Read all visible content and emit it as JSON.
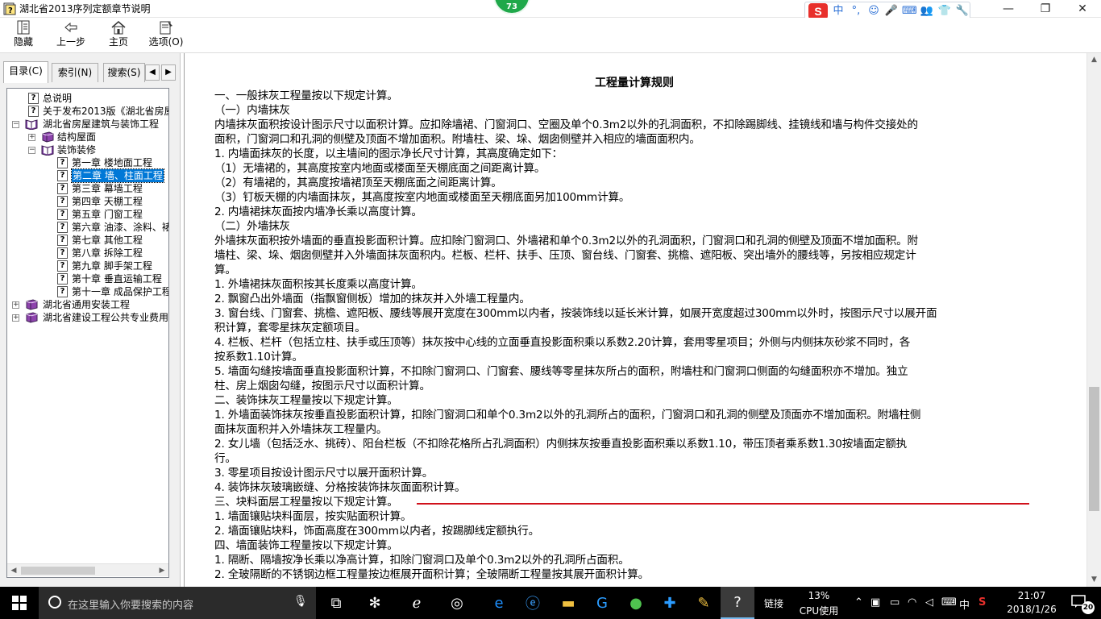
{
  "window": {
    "title": "湖北省2013序列定额章节说明",
    "badge": "73",
    "minimize": "—",
    "maximize": "❐",
    "close": "✕"
  },
  "ime": {
    "logo": "S",
    "items": [
      "中",
      "°,",
      "☺",
      "🎤",
      "⌨",
      "👥",
      "👕",
      "🔧"
    ]
  },
  "toolbar": {
    "hide_label": "隐藏",
    "back_label": "上一步",
    "home_label": "主页",
    "options_label": "选项(O)"
  },
  "nav": {
    "tabs": [
      "目录(C)",
      "索引(N)",
      "搜索(S)"
    ],
    "tab_prev": "◀",
    "tab_next": "▶"
  },
  "tree": [
    {
      "label": "总说明",
      "icon": "help-page-icon",
      "level": 1,
      "expander": ""
    },
    {
      "label": "关于发布2013版《湖北省房屋",
      "icon": "help-page-icon",
      "level": 1,
      "expander": ""
    },
    {
      "label": "湖北省房屋建筑与装饰工程",
      "icon": "open-book-icon",
      "level": 0,
      "expander": "−"
    },
    {
      "label": "结构屋面",
      "icon": "closed-book-icon",
      "level": 1,
      "expander": "+"
    },
    {
      "label": "装饰装修",
      "icon": "open-book-icon",
      "level": 1,
      "expander": "−"
    },
    {
      "label": "第一章 楼地面工程",
      "icon": "help-page-icon",
      "level": 2,
      "expander": ""
    },
    {
      "label": "第二章 墙、柱面工程",
      "icon": "help-page-icon",
      "level": 2,
      "expander": "",
      "selected": true
    },
    {
      "label": "第三章 幕墙工程",
      "icon": "help-page-icon",
      "level": 2,
      "expander": ""
    },
    {
      "label": "第四章 天棚工程",
      "icon": "help-page-icon",
      "level": 2,
      "expander": ""
    },
    {
      "label": "第五章 门窗工程",
      "icon": "help-page-icon",
      "level": 2,
      "expander": ""
    },
    {
      "label": "第六章 油漆、涂料、裱",
      "icon": "help-page-icon",
      "level": 2,
      "expander": ""
    },
    {
      "label": "第七章 其他工程",
      "icon": "help-page-icon",
      "level": 2,
      "expander": ""
    },
    {
      "label": "第八章 拆除工程",
      "icon": "help-page-icon",
      "level": 2,
      "expander": ""
    },
    {
      "label": "第九章 脚手架工程",
      "icon": "help-page-icon",
      "level": 2,
      "expander": ""
    },
    {
      "label": "第十章 垂直运输工程",
      "icon": "help-page-icon",
      "level": 2,
      "expander": ""
    },
    {
      "label": "第十一章 成品保护工程",
      "icon": "help-page-icon",
      "level": 2,
      "expander": ""
    },
    {
      "label": "湖北省通用安装工程",
      "icon": "closed-book-icon",
      "level": 0,
      "expander": "+"
    },
    {
      "label": "湖北省建设工程公共专业费用",
      "icon": "closed-book-icon",
      "level": 0,
      "expander": "+"
    }
  ],
  "document": {
    "title": "工程量计算规则",
    "lines": [
      "一、一般抹灰工程量按以下规定计算。",
      "（一）内墙抹灰",
      "内墙抹灰面积按设计图示尺寸以面积计算。应扣除墙裙、门窗洞口、空圈及单个0.3m2以外的孔洞面积，不扣除踢脚线、挂镜线和墙与构件交接处的",
      "面积，门窗洞口和孔洞的侧壁及顶面不增加面积。附墙柱、梁、垛、烟囱侧壁并入相应的墙面面积内。",
      "1. 内墙面抹灰的长度，以主墙间的图示净长尺寸计算，其高度确定如下：",
      "（1）无墙裙的，其高度按室内地面或楼面至天棚底面之间距离计算。",
      "（2）有墙裙的，其高度按墙裙顶至天棚底面之间距离计算。",
      "（3）钉板天棚的内墙面抹灰，其高度按室内地面或楼面至天棚底面另加100mm计算。",
      "2. 内墙裙抹灰面按内墙净长乘以高度计算。",
      "（二）外墙抹灰",
      "外墙抹灰面积按外墙面的垂直投影面积计算。应扣除门窗洞口、外墙裙和单个0.3m2以外的孔洞面积，门窗洞口和孔洞的侧壁及顶面不增加面积。附",
      "墙柱、梁、垛、烟囱侧壁并入外墙面抹灰面积内。栏板、栏杆、扶手、压顶、窗台线、门窗套、挑檐、遮阳板、突出墙外的腰线等，另按相应规定计",
      "算。",
      "1. 外墙裙抹灰面积按其长度乘以高度计算。",
      "2. 飘窗凸出外墙面（指飘窗侧板）增加的抹灰并入外墙工程量内。",
      "3. 窗台线、门窗套、挑檐、遮阳板、腰线等展开宽度在300mm以内者，按装饰线以延长米计算，如展开宽度超过300mm以外时，按图示尺寸以展开面",
      "积计算，套零星抹灰定额项目。",
      "4. 栏板、栏杆（包括立柱、扶手或压顶等）抹灰按中心线的立面垂直投影面积乘以系数2.20计算，套用零星项目；外侧与内侧抹灰砂浆不同时，各",
      "按系数1.10计算。",
      "5. 墙面勾缝按墙面垂直投影面积计算，不扣除门窗洞口、门窗套、腰线等零星抹灰所占的面积，附墙柱和门窗洞口侧面的勾缝面积亦不增加。独立",
      "柱、房上烟囱勾缝，按图示尺寸以面积计算。",
      "二、装饰抹灰工程量按以下规定计算。",
      "1. 外墙面装饰抹灰按垂直投影面积计算，扣除门窗洞口和单个0.3m2以外的孔洞所占的面积，门窗洞口和孔洞的侧壁及顶面亦不增加面积。附墙柱侧",
      "面抹灰面积并入外墙抹灰工程量内。",
      "2. 女儿墙（包括泛水、挑砖）、阳台栏板（不扣除花格所占孔洞面积）内侧抹灰按垂直投影面积乘以系数1.10，带压顶者乘系数1.30按墙面定额执",
      "行。",
      "3. 零星项目按设计图示尺寸以展开面积计算。",
      "4. 装饰抹灰玻璃嵌缝、分格按装饰抹灰面面积计算。",
      "三、块料面层工程量按以下规定计算。",
      "1. 墙面镶贴块料面层，按实贴面积计算。",
      "2. 墙面镶贴块料，饰面高度在300mm以内者，按踢脚线定额执行。",
      "四、墙面装饰工程量按以下规定计算。",
      "1. 隔断、隔墙按净长乘以净高计算，扣除门窗洞口及单个0.3m2以外的孔洞所占面积。",
      "2. 全玻隔断的不锈钢边框工程量按边框展开面积计算；全玻隔断工程量按其展开面积计算。"
    ]
  },
  "taskbar": {
    "search_placeholder": "在这里输入你要搜索的内容",
    "link_label": "链接",
    "cpu_percent": "13%",
    "cpu_label": "CPU使用",
    "ime_lang": "中",
    "time": "21:07",
    "date": "2018/1/26",
    "notifications": "20"
  }
}
